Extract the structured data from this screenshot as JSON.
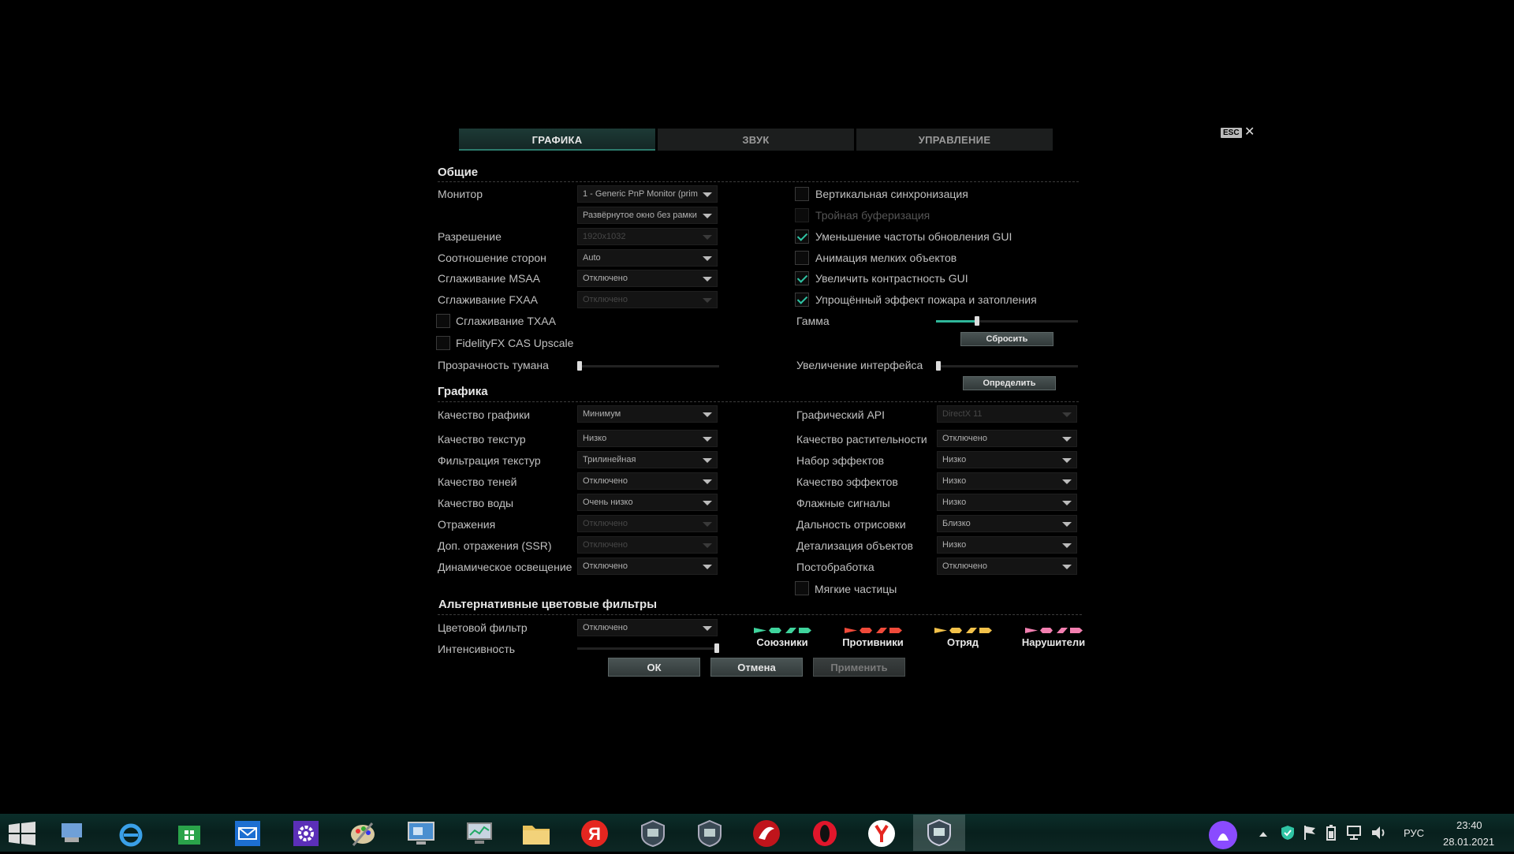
{
  "tabs": {
    "graphics": "ГРАФИКА",
    "sound": "ЗВУК",
    "controls": "УПРАВЛЕНИЕ"
  },
  "esc_label": "ESC",
  "close_glyph": "✕",
  "sections": {
    "general": "Общие",
    "graphics": "Графика",
    "filters": "Альтернативные цветовые фильтры"
  },
  "general": {
    "monitor_label": "Монитор",
    "monitor_value": "1 - Generic PnP Monitor (prim",
    "window_mode_value": "Развёрнутое окно без рамки",
    "resolution_label": "Разрешение",
    "resolution_value": "1920x1032",
    "aspect_label": "Соотношение сторон",
    "aspect_value": "Auto",
    "msaa_label": "Сглаживание MSAA",
    "msaa_value": "Отключено",
    "fxaa_label": "Сглаживание FXAA",
    "fxaa_value": "Отключено",
    "txaa_label": "Сглаживание TXAA",
    "fidelity_label": "FidelityFX CAS Upscale",
    "fog_label": "Прозрачность тумана",
    "fog_level": 0.0,
    "vsync_label": "Вертикальная синхронизация",
    "triple_label": "Тройная буферизация",
    "gui_rate_label": "Уменьшение частоты обновления GUI",
    "anim_label": "Анимация мелких объектов",
    "contrast_label": "Увеличить контрастность GUI",
    "fire_label": "Упрощённый эффект пожара и затопления",
    "gamma_label": "Гамма",
    "gamma_level": 0.28,
    "reset_label": "Сбросить",
    "ui_scale_label": "Увеличение интерфейса",
    "ui_scale_level": 0.0,
    "detect_label": "Определить"
  },
  "graphics": {
    "quality_label": "Качество графики",
    "quality_value": "Минимум",
    "texture_q_label": "Качество текстур",
    "texture_q_value": "Низко",
    "texture_f_label": "Фильтрация текстур",
    "texture_f_value": "Трилинейная",
    "shadow_label": "Качество теней",
    "shadow_value": "Отключено",
    "water_label": "Качество воды",
    "water_value": "Очень низко",
    "refl_label": "Отражения",
    "refl_value": "Отключено",
    "ssr_label": "Доп. отражения (SSR)",
    "ssr_value": "Отключено",
    "dyn_label": "Динамическое освещение",
    "dyn_value": "Отключено",
    "api_label": "Графический API",
    "api_value": "DirectX 11",
    "veg_label": "Качество растительности",
    "veg_value": "Отключено",
    "fxset_label": "Набор эффектов",
    "fxset_value": "Низко",
    "fxq_label": "Качество эффектов",
    "fxq_value": "Низко",
    "flags_label": "Флажные сигналы",
    "flags_value": "Низко",
    "draw_label": "Дальность отрисовки",
    "draw_value": "Близко",
    "detail_label": "Детализация объектов",
    "detail_value": "Низко",
    "post_label": "Постобработка",
    "post_value": "Отключено",
    "soft_label": "Мягкие частицы"
  },
  "filters": {
    "color_label": "Цветовой фильтр",
    "color_value": "Отключено",
    "intensity_label": "Интенсивность",
    "intensity_level": 1.0,
    "legend": [
      {
        "label": "Союзники",
        "color": "#3fd39c"
      },
      {
        "label": "Противники",
        "color": "#f04a3a"
      },
      {
        "label": "Отряд",
        "color": "#f2c14a"
      },
      {
        "label": "Нарушители",
        "color": "#f27fb0"
      }
    ]
  },
  "buttons": {
    "ok": "ОК",
    "cancel": "Отмена",
    "apply": "Применить"
  },
  "taskbar": {
    "icons": [
      "windows-start-icon",
      "explorer-icon",
      "internet-explorer-icon",
      "store-icon",
      "mail-icon",
      "settings-icon",
      "paint-icon",
      "remote-desktop-icon",
      "monitor-icon",
      "folder-icon",
      "yandex-icon",
      "wows-icon",
      "wows-icon-2",
      "wargaming-icon",
      "opera-icon",
      "yandex-browser-icon",
      "wows-active-icon"
    ],
    "yandex_glyph": "Я",
    "lang": "РУС",
    "time": "23:40",
    "date": "28.01.2021",
    "accent": "#2fc4a4"
  }
}
